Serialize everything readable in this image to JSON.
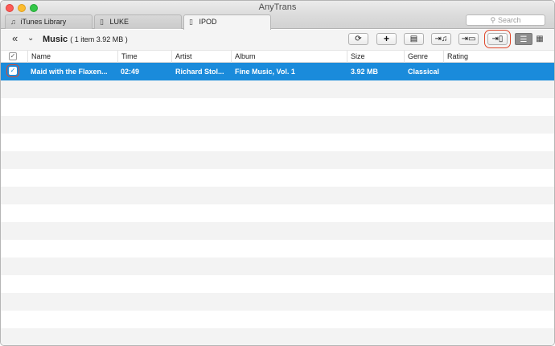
{
  "window": {
    "title": "AnyTrans"
  },
  "tabs": [
    {
      "label": "iTunes Library",
      "icon": "music-note-icon"
    },
    {
      "label": "LUKE",
      "icon": "phone-icon"
    },
    {
      "label": "IPOD",
      "icon": "phone-icon",
      "active": true
    }
  ],
  "search": {
    "placeholder": "Search"
  },
  "toolbar": {
    "title": "Music",
    "summary": "( 1 item  3.92 MB )"
  },
  "table": {
    "columns": [
      "Name",
      "Time",
      "Artist",
      "Album",
      "Size",
      "Genre",
      "Rating"
    ],
    "rows": [
      {
        "selected": true,
        "cells": [
          "Maid with the Flaxen...",
          "02:49",
          "Richard Stol...",
          "Fine Music, Vol. 1",
          "3.92 MB",
          "Classical",
          ""
        ]
      }
    ]
  },
  "colors": {
    "selection": "#1a8bdb",
    "highlight": "#e0472a"
  }
}
